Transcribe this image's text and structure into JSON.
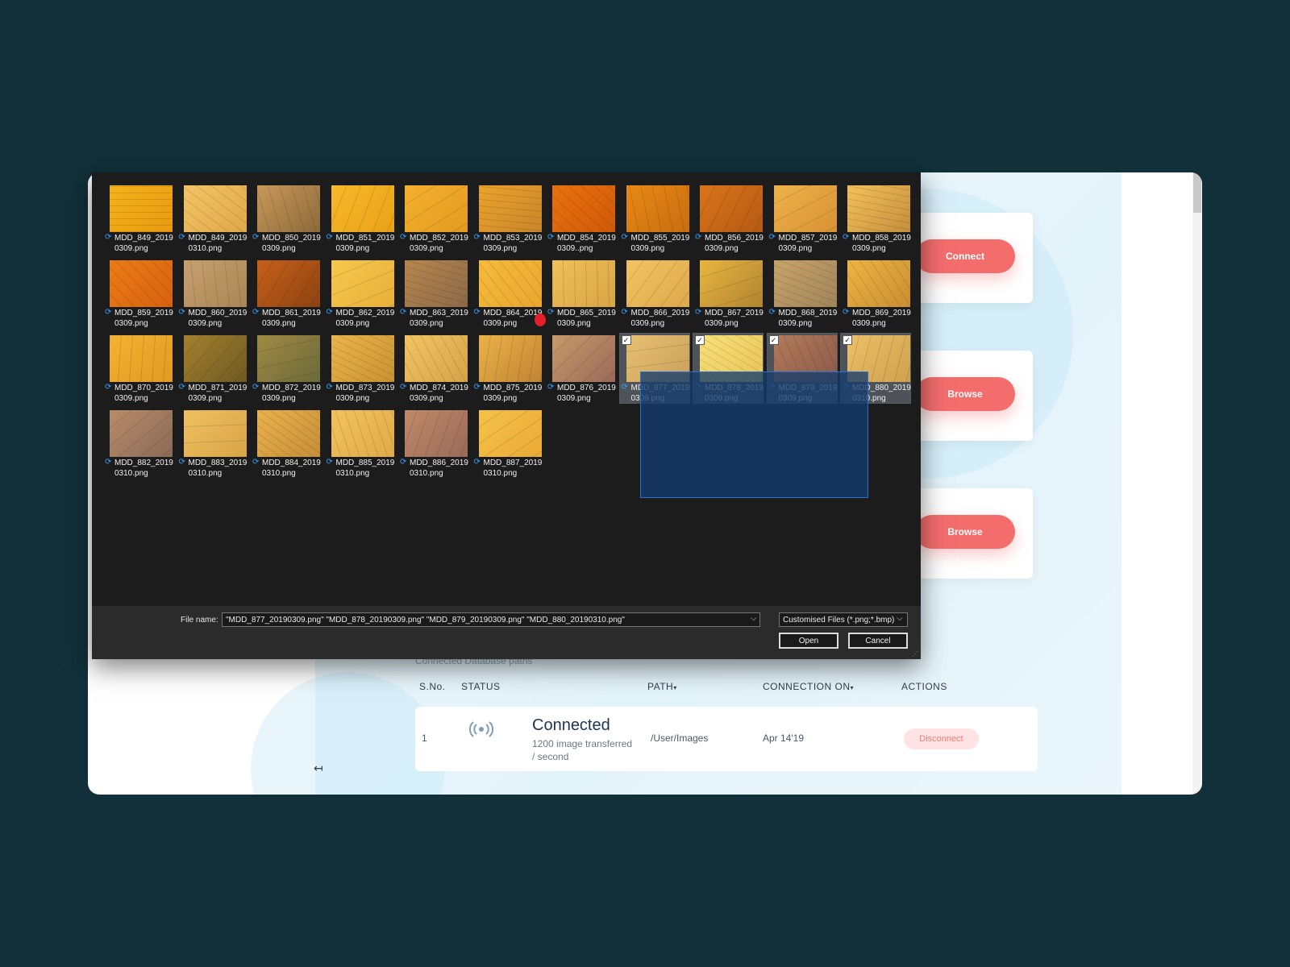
{
  "app": {
    "side_buttons": [
      "Connect",
      "Browse",
      "Browse"
    ],
    "table": {
      "caption": "Connected Database paths",
      "headers": {
        "sno": "S.No.",
        "status": "STATUS",
        "path": "PATH",
        "connection_on": "CONNECTION ON",
        "actions": "ACTIONS"
      },
      "rows": [
        {
          "sno": "1",
          "status_title": "Connected",
          "status_sub": "1200 image transferred / second",
          "path": "/User/Images",
          "date": "Apr 14'19",
          "action": "Disconnect"
        }
      ]
    },
    "colors": {
      "accent": "#f46d6d",
      "background": "#11303a",
      "status": "#1b3550"
    }
  },
  "dialog": {
    "files": [
      {
        "l1": "MDD_849_2019",
        "l2": "0309.png",
        "c": [
          "#f5b21a",
          "#e89a10"
        ],
        "sel": false
      },
      {
        "l1": "MDD_849_2019",
        "l2": "0310.png",
        "c": [
          "#f2c466",
          "#e0a848"
        ],
        "sel": false
      },
      {
        "l1": "MDD_850_2019",
        "l2": "0309.png",
        "c": [
          "#c9985a",
          "#8c6a3a"
        ],
        "sel": false
      },
      {
        "l1": "MDD_851_2019",
        "l2": "0309.png",
        "c": [
          "#f6b829",
          "#eaa218"
        ],
        "sel": false
      },
      {
        "l1": "MDD_852_2019",
        "l2": "0309.png",
        "c": [
          "#f3b12e",
          "#e49a20"
        ],
        "sel": false
      },
      {
        "l1": "MDD_853_2019",
        "l2": "0309.png",
        "c": [
          "#eaa32c",
          "#c9852a"
        ],
        "sel": false
      },
      {
        "l1": "MDD_854_2019",
        "l2": "0309..png",
        "c": [
          "#e8720c",
          "#d0590a"
        ],
        "sel": false
      },
      {
        "l1": "MDD_855_2019",
        "l2": "0309.png",
        "c": [
          "#e88a14",
          "#c86c10"
        ],
        "sel": false
      },
      {
        "l1": "MDD_856_2019",
        "l2": "0309.png",
        "c": [
          "#d9741a",
          "#b55a14"
        ],
        "sel": false
      },
      {
        "l1": "MDD_857_2019",
        "l2": "0309.png",
        "c": [
          "#eeb24a",
          "#d89234"
        ],
        "sel": false
      },
      {
        "l1": "MDD_858_2019",
        "l2": "0309.png",
        "c": [
          "#f2c15a",
          "#c58e3c"
        ],
        "sel": false
      },
      {
        "l1": "MDD_859_2019",
        "l2": "0309.png",
        "c": [
          "#ec7b16",
          "#d8620e"
        ],
        "sel": false
      },
      {
        "l1": "MDD_860_2019",
        "l2": "0309.png",
        "c": [
          "#c7a06e",
          "#a98656"
        ],
        "sel": false
      },
      {
        "l1": "MDD_861_2019",
        "l2": "0309.png",
        "c": [
          "#c8601a",
          "#8c4212"
        ],
        "sel": false
      },
      {
        "l1": "MDD_862_2019",
        "l2": "0309.png",
        "c": [
          "#f6c84c",
          "#e8b03a"
        ],
        "sel": false
      },
      {
        "l1": "MDD_863_2019",
        "l2": "0309.png",
        "c": [
          "#b8874e",
          "#8b6a4a"
        ],
        "sel": false
      },
      {
        "l1": "MDD_864_2019",
        "l2": "0309.png",
        "c": [
          "#f5bb3c",
          "#eaa62e"
        ],
        "sel": false
      },
      {
        "l1": "MDD_865_2019",
        "l2": "0309.png",
        "c": [
          "#efc058",
          "#d8a444"
        ],
        "sel": false
      },
      {
        "l1": "MDD_866_2019",
        "l2": "0309.png",
        "c": [
          "#f2c462",
          "#dda84c"
        ],
        "sel": false
      },
      {
        "l1": "MDD_867_2019",
        "l2": "0309.png",
        "c": [
          "#e8b640",
          "#b08430"
        ],
        "sel": false
      },
      {
        "l1": "MDD_868_2019",
        "l2": "0309.png",
        "c": [
          "#c8a46a",
          "#a0845a"
        ],
        "sel": false
      },
      {
        "l1": "MDD_869_2019",
        "l2": "0309.png",
        "c": [
          "#ecb442",
          "#c98e32"
        ],
        "sel": false
      },
      {
        "l1": "MDD_870_2019",
        "l2": "0309.png",
        "c": [
          "#f4b232",
          "#e09a22"
        ],
        "sel": false
      },
      {
        "l1": "MDD_871_2019",
        "l2": "0309.png",
        "c": [
          "#a4802e",
          "#6e5a22"
        ],
        "sel": false
      },
      {
        "l1": "MDD_872_2019",
        "l2": "0309.png",
        "c": [
          "#a08a44",
          "#6b6a3a"
        ],
        "sel": false
      },
      {
        "l1": "MDD_873_2019",
        "l2": "0309.png",
        "c": [
          "#eab54a",
          "#c99232"
        ],
        "sel": false
      },
      {
        "l1": "MDD_874_2019",
        "l2": "0309.png",
        "c": [
          "#f2c462",
          "#d6a24a"
        ],
        "sel": false
      },
      {
        "l1": "MDD_875_2019",
        "l2": "0309.png",
        "c": [
          "#ecb248",
          "#c08434"
        ],
        "sel": false
      },
      {
        "l1": "MDD_876_2019",
        "l2": "0309.png",
        "c": [
          "#c89a6a",
          "#9a6a5a"
        ],
        "sel": false
      },
      {
        "l1": "MDD_877_2019",
        "l2": "0309.png",
        "c": [
          "#e9c072",
          "#c8a05a"
        ],
        "sel": true
      },
      {
        "l1": "MDD_878_2019",
        "l2": "0309.png",
        "c": [
          "#f8e07a",
          "#e8c456"
        ],
        "sel": true
      },
      {
        "l1": "MDD_879_2019",
        "l2": "0309.png",
        "c": [
          "#b47a5a",
          "#8a5a4a"
        ],
        "sel": true
      },
      {
        "l1": "MDD_880_2019",
        "l2": "0310.png",
        "c": [
          "#eec068",
          "#cfa04e"
        ],
        "sel": true
      },
      {
        "l1": "MDD_882_2019",
        "l2": "0310.png",
        "c": [
          "#b88c6a",
          "#8a6a58"
        ],
        "sel": false
      },
      {
        "l1": "MDD_883_2019",
        "l2": "0310.png",
        "c": [
          "#efc062",
          "#d8a448"
        ],
        "sel": false
      },
      {
        "l1": "MDD_884_2019",
        "l2": "0310.png",
        "c": [
          "#eab24c",
          "#c68e38"
        ],
        "sel": false
      },
      {
        "l1": "MDD_885_2019",
        "l2": "0310.png",
        "c": [
          "#f2c25e",
          "#e0aa48"
        ],
        "sel": false
      },
      {
        "l1": "MDD_886_2019",
        "l2": "0310.png",
        "c": [
          "#c08a6a",
          "#9a6a58"
        ],
        "sel": false
      },
      {
        "l1": "MDD_887_2019",
        "l2": "0310.png",
        "c": [
          "#f6c24a",
          "#eaaa36"
        ],
        "sel": false
      }
    ],
    "file_name_label": "File name:",
    "file_name_value": "\"MDD_877_20190309.png\" \"MDD_878_20190309.png\" \"MDD_879_20190309.png\" \"MDD_880_20190310.png\"",
    "filter_value": "Customised Files (*.png;*.bmp)",
    "open_label": "Open",
    "cancel_label": "Cancel",
    "icons": {
      "sync": "sync-icon",
      "check": "checkbox-checked-icon",
      "dropdown": "chevron-down-icon",
      "signal": "signal-icon",
      "collapse": "collapse-left-icon"
    }
  }
}
